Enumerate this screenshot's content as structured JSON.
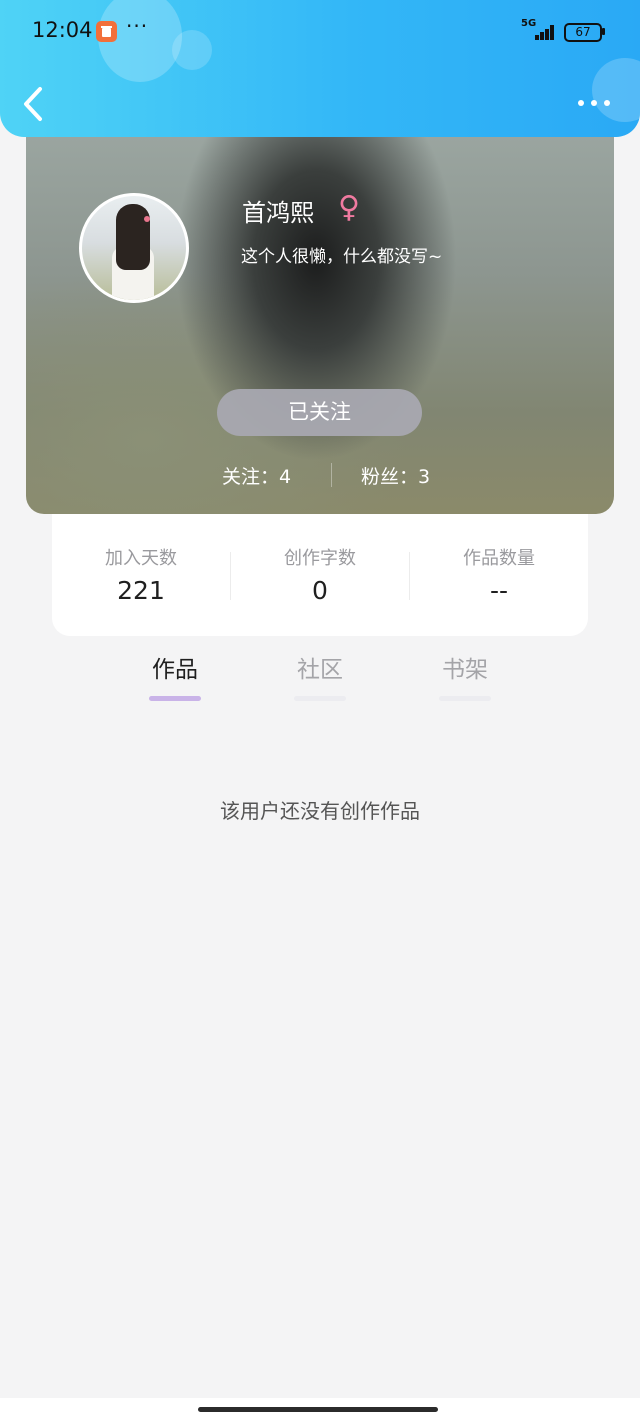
{
  "status_bar": {
    "time": "12:04",
    "app_icon": "trash-app-icon",
    "more_dots": "···",
    "network": "5G",
    "battery": "67"
  },
  "nav": {
    "back_icon": "chevron-left-icon",
    "more_icon": "more-horizontal-icon"
  },
  "profile": {
    "name": "首鸿熙",
    "gender_symbol": "♀",
    "gender_color": "#f07aa0",
    "bio": "这个人很懒，什么都没写~",
    "follow_button": "已关注",
    "following": "关注：4",
    "fans": "粉丝：3"
  },
  "stats": [
    {
      "label": "加入天数",
      "value": "221"
    },
    {
      "label": "创作字数",
      "value": "0"
    },
    {
      "label": "作品数量",
      "value": "--"
    }
  ],
  "tabs": [
    {
      "label": "作品",
      "active": true
    },
    {
      "label": "社区",
      "active": false
    },
    {
      "label": "书架",
      "active": false
    }
  ],
  "empty_message": "该用户还没有创作作品",
  "colors": {
    "header_gradient_start": "#4fd3f6",
    "header_gradient_end": "#2aa9f5",
    "active_tab_indicator": "#c9b3e8"
  }
}
